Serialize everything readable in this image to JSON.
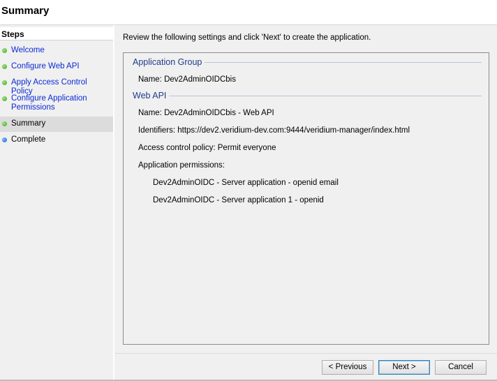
{
  "header": {
    "title": "Summary"
  },
  "sidebar": {
    "title": "Steps",
    "steps": [
      {
        "label": "Welcome",
        "state": "done"
      },
      {
        "label": "Configure Web API",
        "state": "done"
      },
      {
        "label": "Apply Access Control Policy",
        "state": "done"
      },
      {
        "label": "Configure Application Permissions",
        "state": "done"
      },
      {
        "label": "Summary",
        "state": "current"
      },
      {
        "label": "Complete",
        "state": "pending"
      }
    ]
  },
  "main": {
    "intro": "Review the following settings and click 'Next' to create the application.",
    "application_group": {
      "title": "Application Group",
      "name": "Name: Dev2AdminOIDCbis"
    },
    "web_api": {
      "title": "Web API",
      "name": "Name: Dev2AdminOIDCbis - Web API",
      "identifiers": "Identifiers: https://dev2.veridium-dev.com:9444/veridium-manager/index.html",
      "access_policy": "Access control policy: Permit everyone",
      "permissions_label": "Application permissions:",
      "permissions": [
        "Dev2AdminOIDC - Server application - openid email",
        "Dev2AdminOIDC - Server application 1 - openid"
      ]
    }
  },
  "buttons": {
    "previous": "< Previous",
    "next": "Next >",
    "cancel": "Cancel"
  },
  "colors": {
    "link": "#0a2ad6",
    "group_title": "#1f3c8c",
    "done_dot": "#3da51f",
    "pending_dot": "#1f63d6"
  }
}
